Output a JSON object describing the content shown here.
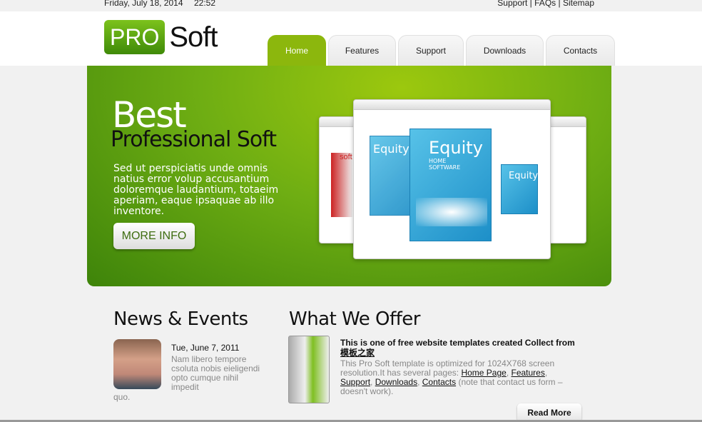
{
  "topbar": {
    "date": "Friday, July 18, 2014",
    "time": "22:52",
    "links": [
      "Support",
      "FAQs",
      "Sitemap"
    ],
    "separator": "|"
  },
  "logo": {
    "pro": "PRO",
    "soft": "Soft"
  },
  "nav": [
    {
      "label": "Home",
      "active": true
    },
    {
      "label": "Features"
    },
    {
      "label": "Support"
    },
    {
      "label": "Downloads"
    },
    {
      "label": "Contacts"
    }
  ],
  "banner": {
    "title1": "Best",
    "title2": "Professional Soft",
    "text": "Sed ut perspiciatis unde omnis natius error volup accusantium doloremque laudantium, totaeim aperiam, eaque ipsaquae ab illo inventore.",
    "button": "MORE INFO",
    "product": {
      "name": "Equity",
      "sub1": "HOME",
      "sub2": "SOFTWARE",
      "side_label": "soft"
    }
  },
  "news": {
    "heading": "News & Events",
    "date": "Tue, June 7, 2011",
    "text": "Nam libero tempore csoluta nobis eieligendi opto cumque nihil impedit",
    "tail": "quo."
  },
  "offer": {
    "heading": "What We Offer",
    "title": "This is one of free website templates created Collect from",
    "title_link": "模板之家",
    "text_pre": "This Pro Soft template is optimized for 1024X768 screen resolution.It has several pages:",
    "links": [
      "Home Page",
      "Features",
      "Support",
      "Downloads",
      "Contacts"
    ],
    "text_post": "(note that contact us form – doesn't work).",
    "button": "Read More"
  },
  "colors": {
    "accent": "#8cb70d",
    "banner_dark": "#3e840a"
  }
}
